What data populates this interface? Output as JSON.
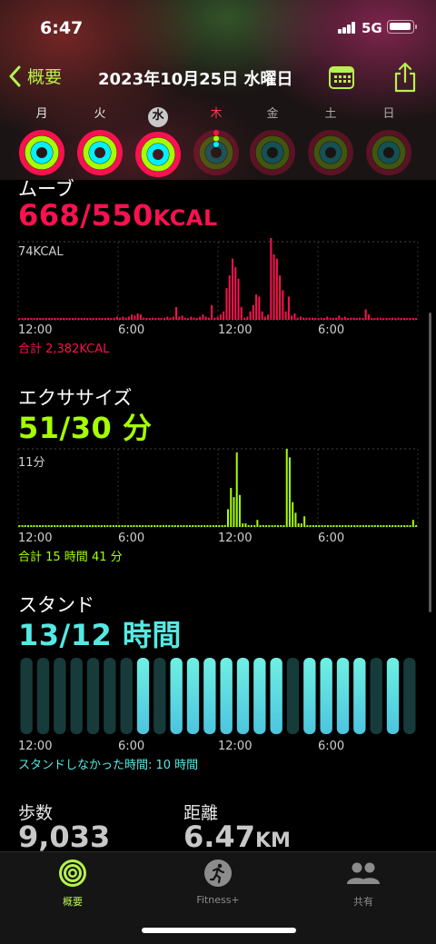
{
  "status": {
    "time": "6:47",
    "network": "5G"
  },
  "nav": {
    "back_label": "概要",
    "title": "2023年10月25日 水曜日"
  },
  "week": [
    {
      "label": "月",
      "state": "past",
      "move": 1.0,
      "exercise": 1.0,
      "stand": 1.0
    },
    {
      "label": "火",
      "state": "past",
      "move": 1.0,
      "exercise": 1.0,
      "stand": 1.0
    },
    {
      "label": "水",
      "state": "today",
      "move": 1.0,
      "exercise": 1.0,
      "stand": 1.0
    },
    {
      "label": "木",
      "state": "current",
      "move": 0.0,
      "exercise": 0.0,
      "stand": 0.0
    },
    {
      "label": "金",
      "state": "future"
    },
    {
      "label": "土",
      "state": "future"
    },
    {
      "label": "日",
      "state": "future"
    }
  ],
  "colors": {
    "move": "#fa114f",
    "exercise": "#a6ff00",
    "stand": "#00f0ff",
    "accent": "#b6f24d"
  },
  "move": {
    "title": "ムーブ",
    "value": "668/550",
    "unit": "KCAL",
    "max_label": "74KCAL",
    "total": "合計 2,382KCAL"
  },
  "exercise": {
    "title": "エクササイズ",
    "value": "51/30 分",
    "max_label": "11分",
    "total": "合計 15 時間 41 分"
  },
  "stand": {
    "title": "スタンド",
    "value": "13/12 時間",
    "total": "スタンドしなかった時間: 10 時間"
  },
  "axis_ticks": [
    "12:00",
    "6:00",
    "12:00",
    "6:00"
  ],
  "stats": {
    "steps_label": "歩数",
    "steps_value": "9,033",
    "distance_label": "距離",
    "distance_value": "6.47",
    "distance_unit": "KM"
  },
  "tabs": [
    {
      "label": "概要",
      "icon": "activity-rings-icon",
      "active": true
    },
    {
      "label": "Fitness+",
      "icon": "runner-icon",
      "active": false
    },
    {
      "label": "共有",
      "icon": "people-icon",
      "active": false
    }
  ],
  "chart_data": [
    {
      "type": "bar",
      "title": "ムーブ",
      "ylabel": "KCAL",
      "x_ticks": [
        "12:00",
        "6:00",
        "12:00",
        "6:00"
      ],
      "ymax": 74,
      "values": [
        1,
        1,
        1,
        1,
        1,
        1,
        1,
        1,
        1,
        1,
        1,
        1,
        1,
        1,
        1,
        1,
        1,
        1,
        1,
        1,
        1,
        1,
        1,
        1,
        1,
        1,
        1,
        1,
        1,
        1,
        2,
        1,
        2,
        3,
        2,
        3,
        2,
        3,
        5,
        4,
        6,
        5,
        2,
        1,
        1,
        2,
        1,
        2,
        1,
        2,
        3,
        2,
        3,
        12,
        3,
        4,
        2,
        1,
        3,
        2,
        1,
        3,
        5,
        3,
        2,
        14,
        2,
        3,
        5,
        8,
        30,
        42,
        58,
        50,
        39,
        12,
        2,
        3,
        8,
        14,
        24,
        22,
        8,
        3,
        5,
        80,
        62,
        58,
        42,
        28,
        8,
        22,
        4,
        6,
        2,
        3,
        2,
        2,
        2,
        2,
        1,
        1,
        2,
        1,
        3,
        2,
        1,
        2,
        4,
        2,
        3,
        1,
        2,
        2,
        1,
        2,
        1,
        10,
        5,
        1,
        1,
        2,
        2,
        1,
        1,
        1,
        2,
        1,
        2,
        1,
        1,
        1,
        1,
        1,
        1
      ]
    },
    {
      "type": "bar",
      "title": "エクササイズ",
      "ylabel": "分",
      "x_ticks": [
        "12:00",
        "6:00",
        "12:00",
        "6:00"
      ],
      "ymax": 11,
      "values": [
        0.2,
        0.2,
        0.2,
        0.2,
        0.2,
        0.2,
        0.2,
        0.2,
        0.2,
        0.2,
        0.2,
        0.2,
        0.2,
        0.2,
        0.2,
        0.2,
        0.2,
        0.2,
        0.2,
        0.2,
        0.2,
        0.2,
        0.2,
        0.2,
        0.2,
        0.2,
        0.2,
        0.2,
        0.2,
        0.2,
        0.2,
        0.2,
        0.2,
        0.2,
        0.2,
        0.2,
        0.2,
        0.2,
        0.2,
        0.2,
        0.2,
        0.2,
        0.2,
        0.2,
        0.2,
        0.2,
        0.2,
        0.2,
        0.2,
        0.2,
        0.2,
        0.2,
        0.2,
        0.2,
        0.2,
        0.2,
        0.2,
        0.2,
        0.2,
        0.2,
        0.2,
        0.2,
        0.2,
        0.2,
        0.2,
        0.2,
        0.2,
        0.2,
        0.2,
        0.2,
        0.2,
        2.5,
        5.5,
        4.2,
        10.5,
        4.5,
        0.5,
        0.5,
        0.2,
        0.2,
        0.2,
        1.0,
        0.2,
        0.2,
        0.2,
        0.2,
        0.2,
        0.2,
        0.2,
        0.2,
        0.2,
        11,
        9.8,
        3.5,
        2,
        0.5,
        0.5,
        1.5,
        0.2,
        0.2,
        0.2,
        0.2,
        0.2,
        0.2,
        0.2,
        0.2,
        0.2,
        0.2,
        0.2,
        0.2,
        0.2,
        0.2,
        0.2,
        0.2,
        0.2,
        0.2,
        0.2,
        0.2,
        0.2,
        0.2,
        0.2,
        0.2,
        0.2,
        0.2,
        0.2,
        0.2,
        0.2,
        0.2,
        0.2,
        0.2,
        0.2,
        0.2,
        0.2,
        0.2,
        1.0,
        0.2
      ]
    },
    {
      "type": "bar",
      "title": "スタンド",
      "x_ticks": [
        "12:00",
        "6:00",
        "12:00",
        "6:00"
      ],
      "hours": [
        0,
        0,
        0,
        0,
        0,
        0,
        0,
        1,
        0,
        1,
        1,
        1,
        1,
        1,
        1,
        1,
        0,
        1,
        1,
        1,
        1,
        0,
        1,
        0
      ]
    }
  ]
}
